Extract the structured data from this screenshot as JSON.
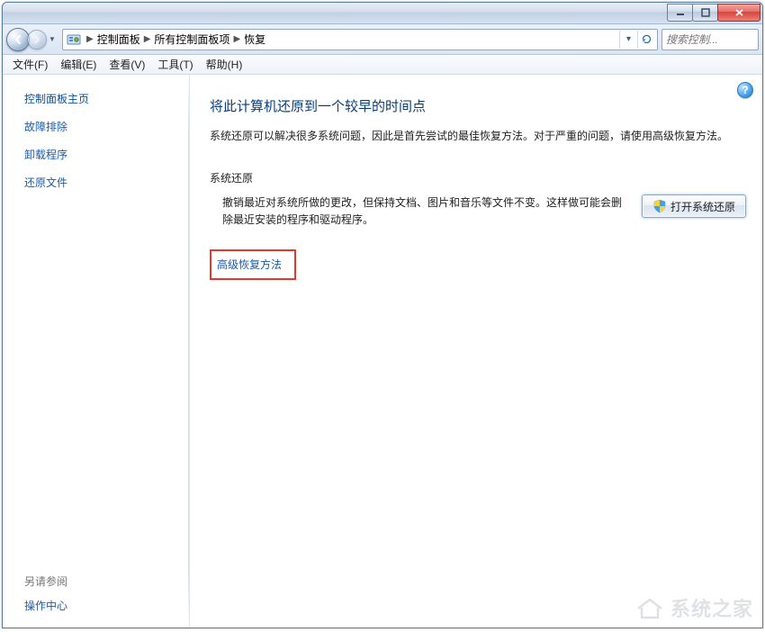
{
  "window": {
    "min_tip": "最小化",
    "max_tip": "最大化",
    "close_tip": "关闭"
  },
  "breadcrumb": {
    "root": "控制面板",
    "mid": "所有控制面板项",
    "leaf": "恢复"
  },
  "search": {
    "placeholder": "搜索控制..."
  },
  "menu": {
    "file": "文件(F)",
    "edit": "编辑(E)",
    "view": "查看(V)",
    "tools": "工具(T)",
    "help": "帮助(H)"
  },
  "sidebar": {
    "home": "控制面板主页",
    "troubleshoot": "故障排除",
    "uninstall": "卸载程序",
    "restore_files": "还原文件",
    "see_also_title": "另请参阅",
    "action_center": "操作中心"
  },
  "content": {
    "title": "将此计算机还原到一个较早的时间点",
    "intro": "系统还原可以解决很多系统问题，因此是首先尝试的最佳恢复方法。对于严重的问题，请使用高级恢复方法。",
    "section_title": "系统还原",
    "restore_desc": "撤销最近对系统所做的更改，但保持文档、图片和音乐等文件不变。这样做可能会删除最近安装的程序和驱动程序。",
    "open_restore_btn": "打开系统还原",
    "advanced_link": "高级恢复方法"
  },
  "help_tip": "?",
  "watermark": "系统之家"
}
